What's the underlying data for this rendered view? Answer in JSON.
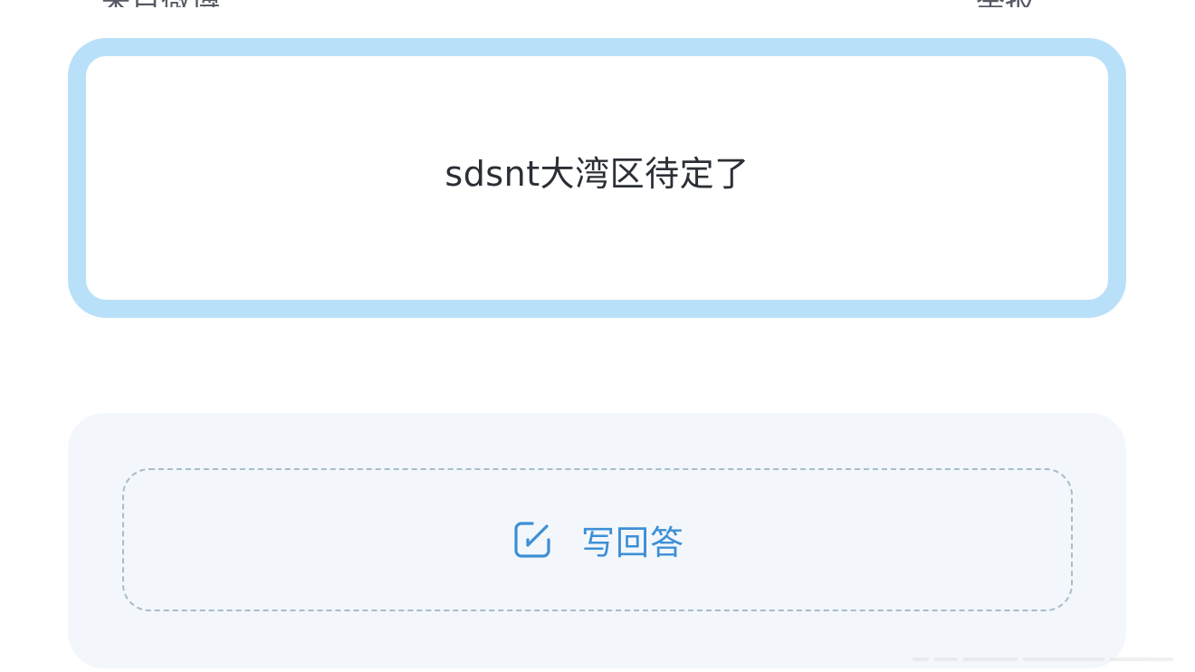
{
  "top_bar": {
    "left_text": "来自微博",
    "right_text": "举报"
  },
  "question": {
    "text": "sdsnt大湾区待定了"
  },
  "answer": {
    "write_label": "写回答",
    "icon": "edit-icon"
  },
  "colors": {
    "question_border": "#b9e0f9",
    "answer_panel_bg": "#f3f7fb",
    "dashed_border": "#a9bccb",
    "accent": "#3d8fd6",
    "text": "#2b2f36"
  }
}
